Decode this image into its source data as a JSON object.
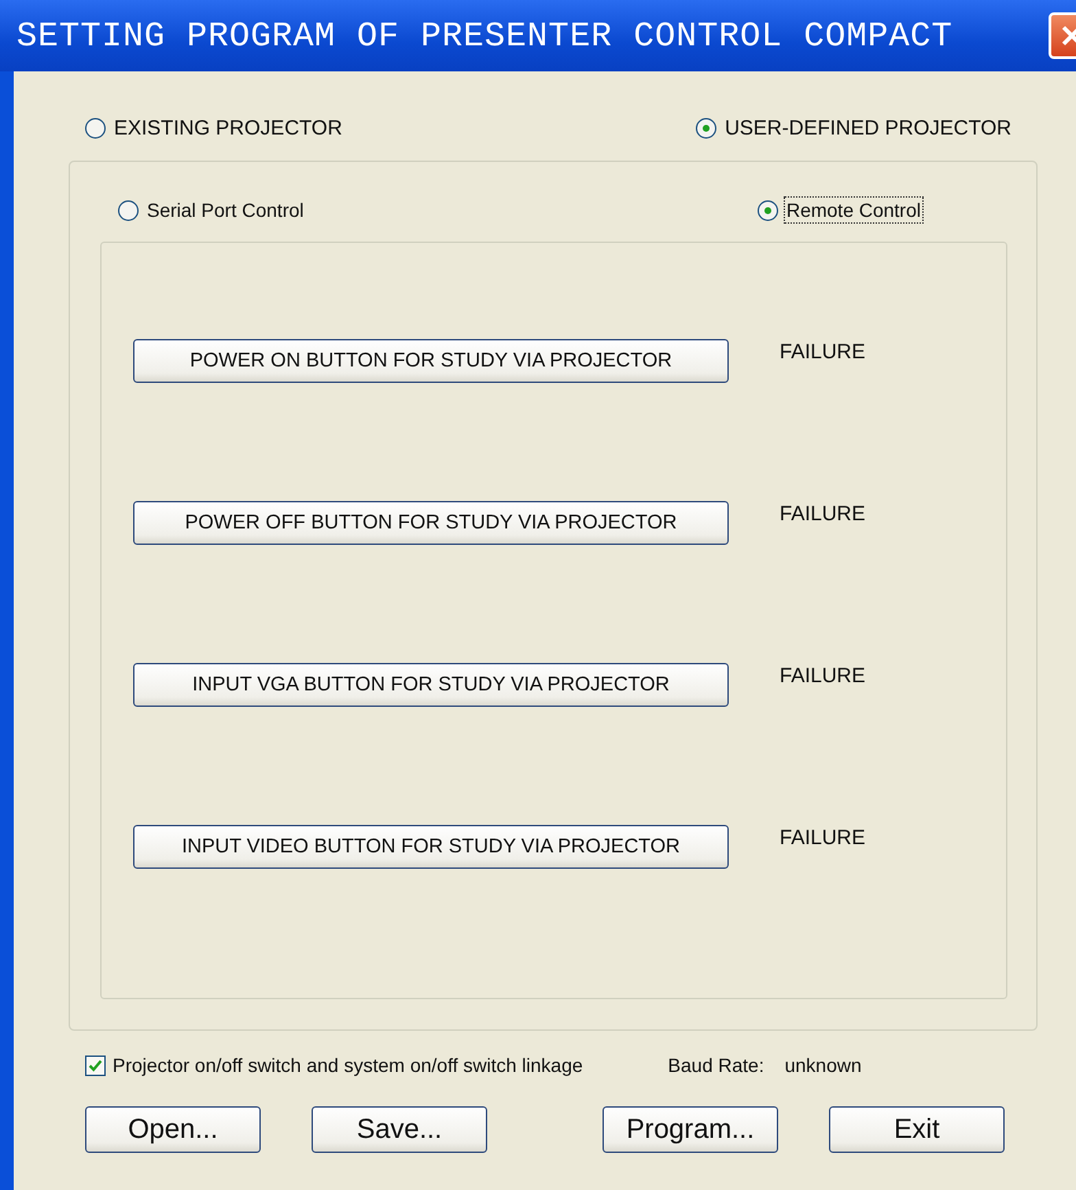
{
  "window": {
    "title": "SETTING PROGRAM OF PRESENTER CONTROL COMPACT"
  },
  "projector_type": [
    {
      "label": "EXISTING PROJECTOR",
      "selected": false
    },
    {
      "label": "USER-DEFINED PROJECTOR",
      "selected": true
    }
  ],
  "control_mode": [
    {
      "label": "Serial Port Control",
      "selected": false,
      "focused": false
    },
    {
      "label": "Remote Control",
      "selected": true,
      "focused": true
    }
  ],
  "actions": [
    {
      "button": "POWER ON BUTTON FOR STUDY VIA PROJECTOR",
      "status": "FAILURE"
    },
    {
      "button": "POWER OFF BUTTON FOR STUDY VIA PROJECTOR",
      "status": "FAILURE"
    },
    {
      "button": "INPUT VGA BUTTON FOR STUDY VIA PROJECTOR",
      "status": "FAILURE"
    },
    {
      "button": "INPUT VIDEO BUTTON FOR STUDY VIA PROJECTOR",
      "status": "FAILURE"
    }
  ],
  "linkage": {
    "label": "Projector on/off switch and system on/off switch linkage",
    "checked": true
  },
  "baud_rate": {
    "label": "Baud Rate:",
    "value": "unknown"
  },
  "buttons": [
    "Open...",
    "Save...",
    "Program...",
    "Exit"
  ]
}
